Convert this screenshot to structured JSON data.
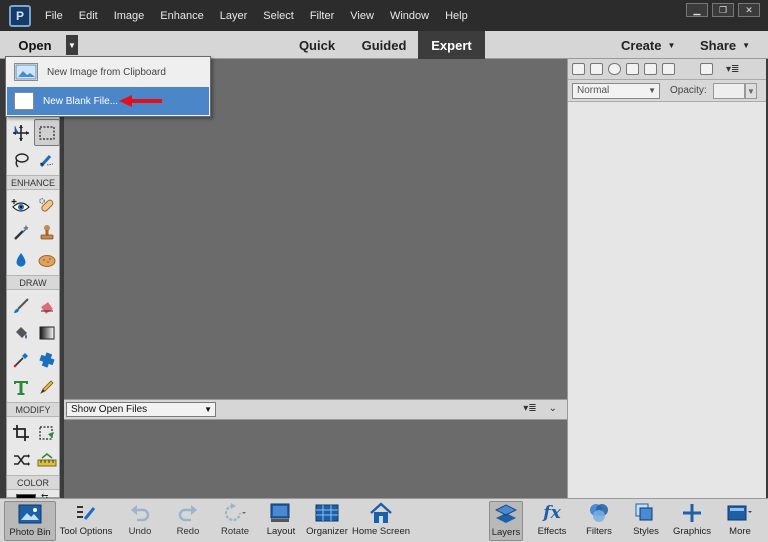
{
  "menubar": {
    "items": [
      "File",
      "Edit",
      "Image",
      "Enhance",
      "Layer",
      "Select",
      "Filter",
      "View",
      "Window",
      "Help"
    ]
  },
  "modebar": {
    "open_label": "Open",
    "tabs": [
      "Quick",
      "Guided",
      "Expert"
    ],
    "active_tab": "Expert",
    "create_label": "Create",
    "share_label": "Share"
  },
  "open_menu": {
    "items": [
      {
        "label": "New Image from Clipboard"
      },
      {
        "label": "New Blank File..."
      }
    ],
    "highlighted": "New Blank File..."
  },
  "toolbar": {
    "sections": {
      "enhance": "ENHANCE",
      "draw": "DRAW",
      "modify": "MODIFY",
      "color": "COLOR"
    }
  },
  "photo_bin": {
    "selector_value": "Show Open Files"
  },
  "layers_panel": {
    "blend_mode": "Normal",
    "opacity_label": "Opacity:"
  },
  "bottombar": {
    "left": [
      "Photo Bin",
      "Tool Options",
      "Undo",
      "Redo",
      "Rotate",
      "Layout",
      "Organizer",
      "Home Screen"
    ],
    "right": [
      "Layers",
      "Effects",
      "Filters",
      "Styles",
      "Graphics",
      "More"
    ]
  },
  "colors": {
    "accent_highlight": "#4a86c8",
    "arrow_red": "#e0101c",
    "canvas_gray": "#6b6b6b"
  }
}
